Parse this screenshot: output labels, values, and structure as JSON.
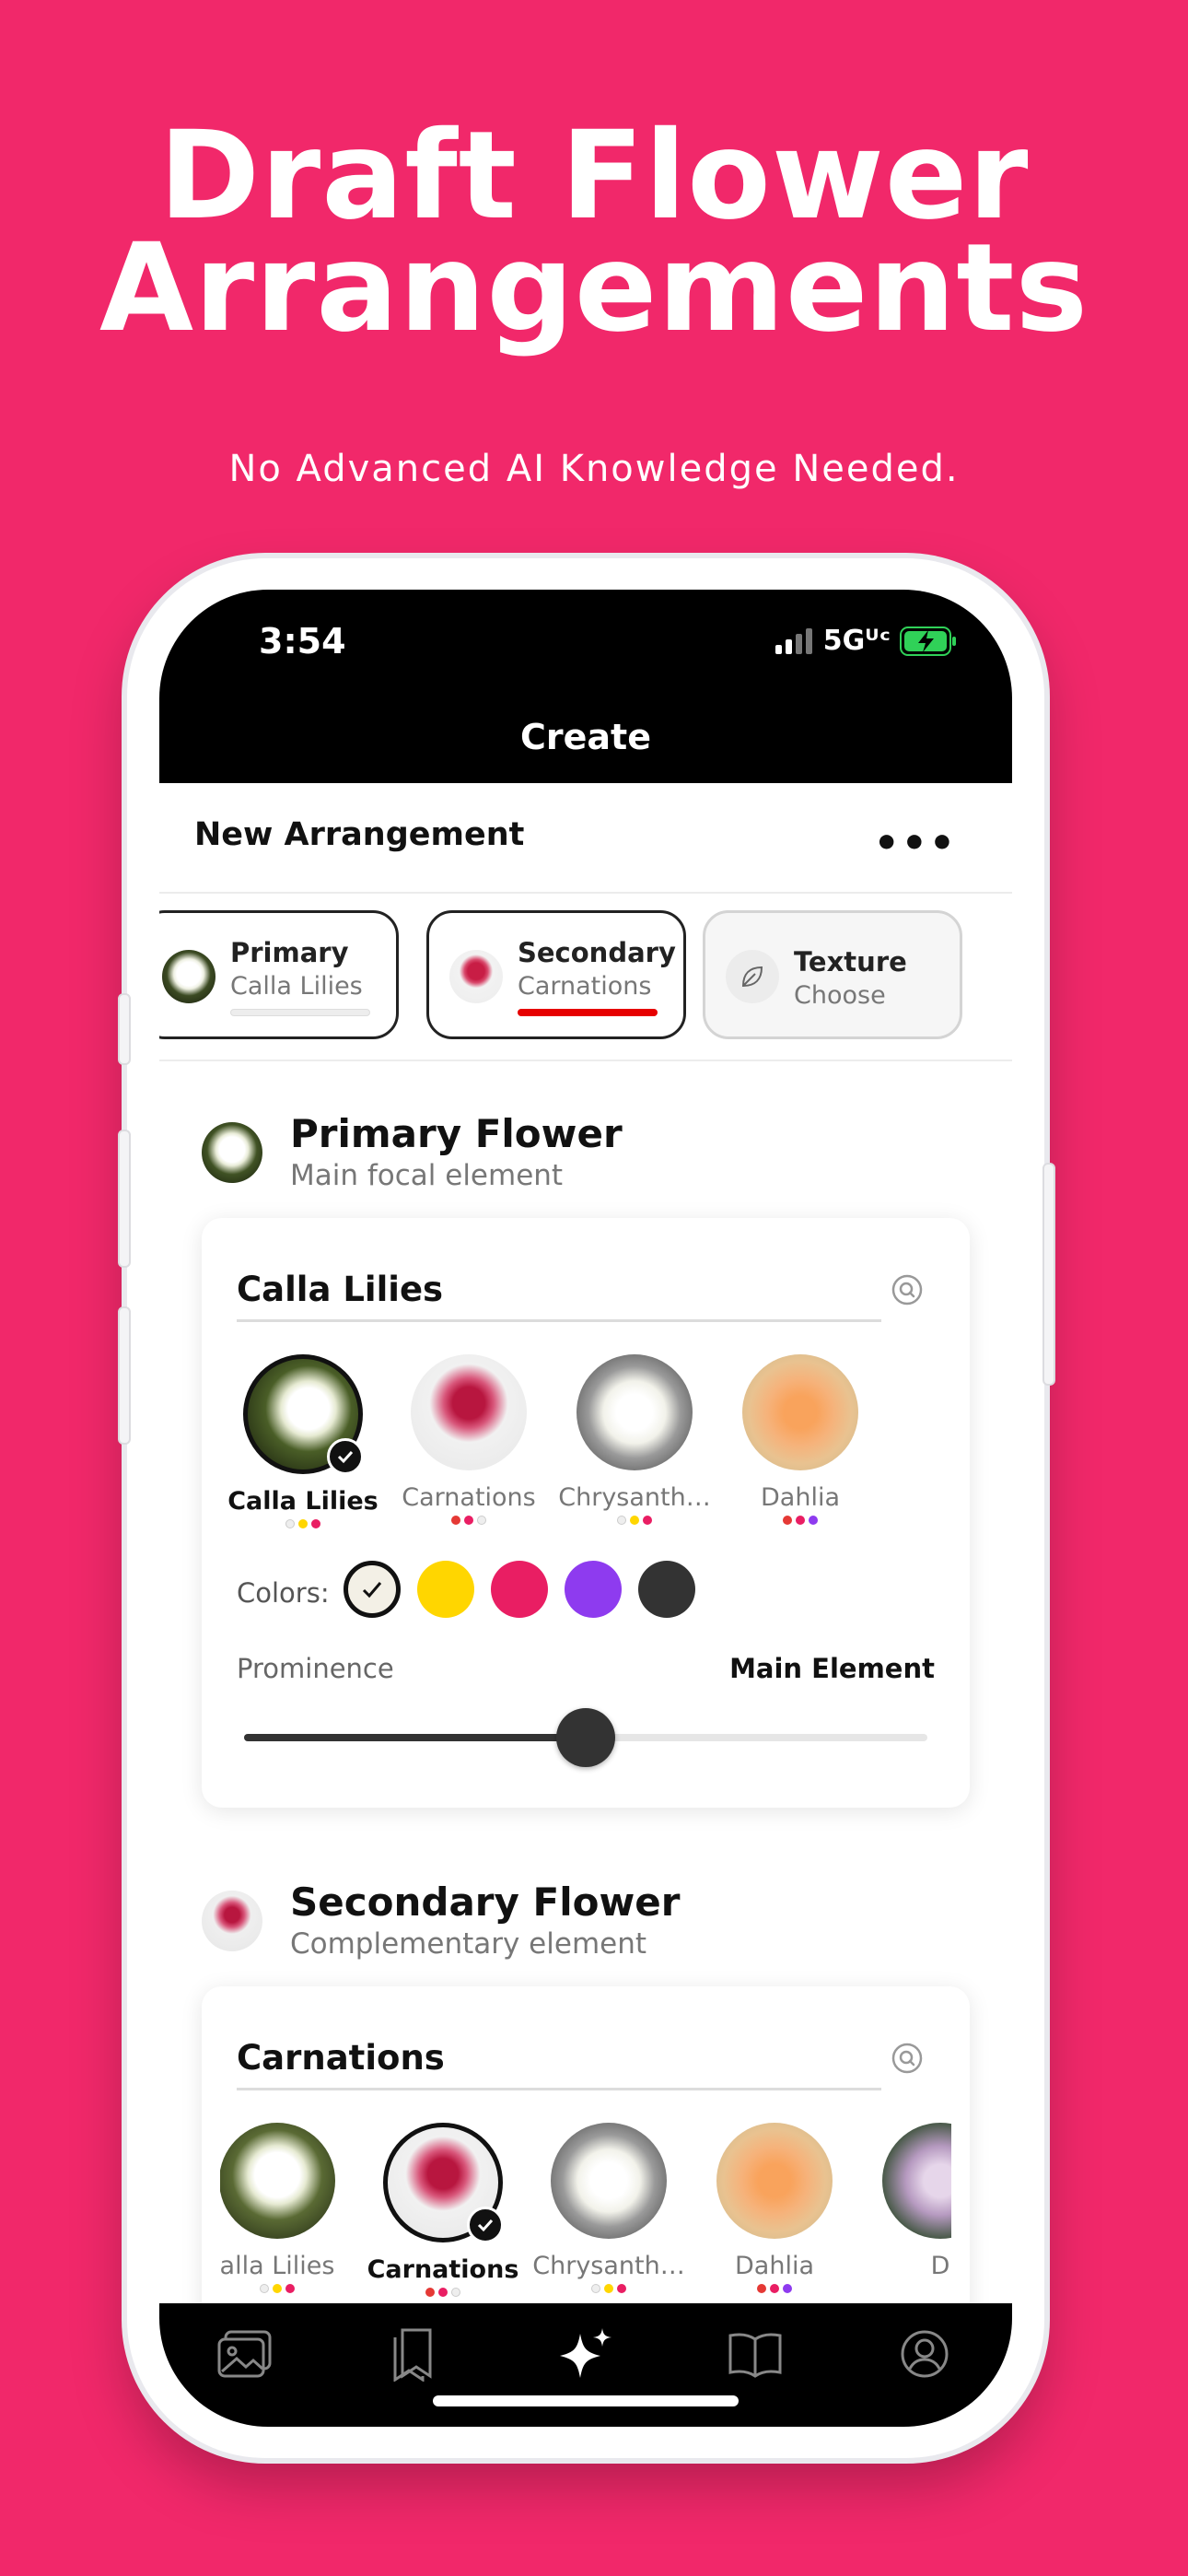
{
  "headline": {
    "line1": "Draft Flower",
    "line2": "Arrangements"
  },
  "subheadline": "No Advanced AI Knowledge Needed.",
  "status_bar": {
    "time": "3:54",
    "network": "5Gᵁᶜ"
  },
  "nav": {
    "title": "Create"
  },
  "header": {
    "title": "New Arrangement",
    "more_icon": "•••"
  },
  "tabs": [
    {
      "title": "Primary",
      "subtitle": "Calla Lilies",
      "state": "done"
    },
    {
      "title": "Secondary",
      "subtitle": "Carnations",
      "state": "active"
    },
    {
      "title": "Texture",
      "subtitle": "Choose",
      "state": "inactive"
    }
  ],
  "primary_section": {
    "title": "Primary Flower",
    "subtitle": "Main focal element",
    "card_title": "Calla Lilies",
    "flowers": [
      {
        "name": "Calla Lilies",
        "selected": true
      },
      {
        "name": "Carnations",
        "selected": false
      },
      {
        "name": "Chrysanth…",
        "selected": false
      },
      {
        "name": "Dahlia",
        "selected": false
      }
    ],
    "colors_label": "Colors:",
    "prominence_label": "Prominence",
    "prominence_value": "Main Element",
    "prominence_level": 0.5
  },
  "secondary_section": {
    "title": "Secondary Flower",
    "subtitle": "Complementary element",
    "card_title": "Carnations",
    "flowers": [
      {
        "name": "alla Lilies",
        "selected": false
      },
      {
        "name": "Carnations",
        "selected": true
      },
      {
        "name": "Chrysanth…",
        "selected": false
      },
      {
        "name": "Dahlia",
        "selected": false
      },
      {
        "name": "D",
        "selected": false
      }
    ]
  },
  "colors": {
    "brand": "#F1286A",
    "swatches": [
      "#F3F0E6",
      "#FFD600",
      "#E91E63",
      "#8E3BEF",
      "#333333"
    ],
    "tab_underline": "#E60000"
  },
  "tab_bar": [
    "gallery-icon",
    "bookmarks-icon",
    "sparkles-icon",
    "book-icon",
    "profile-icon"
  ]
}
